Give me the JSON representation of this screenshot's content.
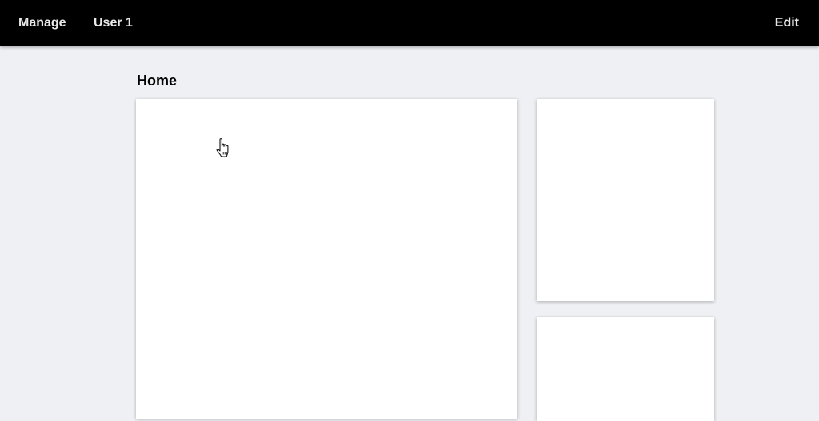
{
  "topbar": {
    "left_links": [
      {
        "label": "Manage"
      },
      {
        "label": "User 1"
      }
    ],
    "right_link": {
      "label": "Edit"
    },
    "background": "#000000",
    "text_color": "#e9e9e9"
  },
  "page": {
    "title": "Home",
    "background": "#eff0f4"
  },
  "cards": {
    "main": {
      "content": ""
    },
    "side_top": {
      "content": ""
    },
    "side_bottom": {
      "content": ""
    }
  },
  "cursor": {
    "icon": "hand-pointer-icon"
  }
}
